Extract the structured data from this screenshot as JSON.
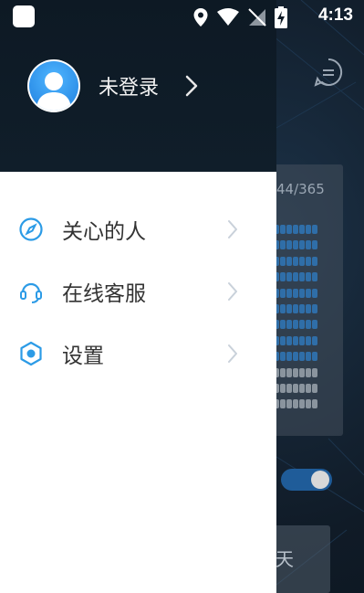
{
  "status_bar": {
    "time": "4:13"
  },
  "drawer": {
    "profile": {
      "label": "未登录"
    },
    "menu": [
      {
        "label": "关心的人",
        "icon": "compass-icon"
      },
      {
        "label": "在线客服",
        "icon": "headset-icon"
      },
      {
        "label": "设置",
        "icon": "settings-icon"
      }
    ]
  },
  "background": {
    "count_text": "44/365",
    "bottom_text": "天"
  },
  "colors": {
    "accent": "#2c9be6",
    "drawer_header": "#101e2a",
    "menu_text": "#333333"
  }
}
